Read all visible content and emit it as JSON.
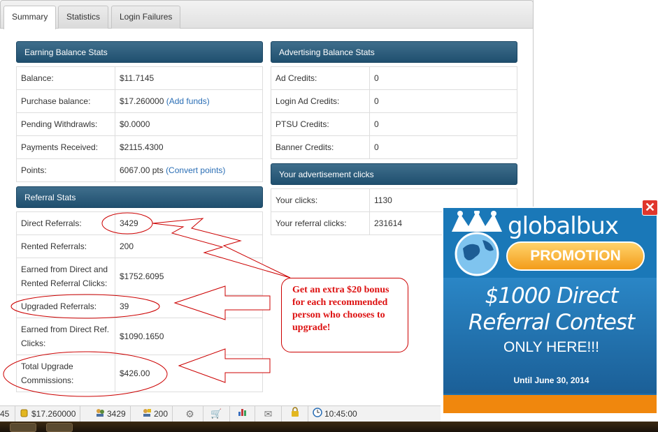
{
  "tabs": [
    {
      "label": "Summary",
      "active": true
    },
    {
      "label": "Statistics",
      "active": false
    },
    {
      "label": "Login Failures",
      "active": false
    }
  ],
  "earning": {
    "title": "Earning Balance Stats",
    "rows": [
      {
        "label": "Balance:",
        "value": "$11.7145"
      },
      {
        "label": "Purchase balance:",
        "value": "$17.260000",
        "link": "(Add funds)"
      },
      {
        "label": "Pending Withdrawls:",
        "value": "$0.0000"
      },
      {
        "label": "Payments Received:",
        "value": "$2115.4300"
      },
      {
        "label": "Points:",
        "value": "6067.00 pts",
        "link": "(Convert points)"
      }
    ]
  },
  "referral": {
    "title": "Referral Stats",
    "rows": [
      {
        "label": "Direct Referrals:",
        "value": "3429"
      },
      {
        "label": "Rented Referrals:",
        "value": "200"
      },
      {
        "label": "Earned from Direct and Rented Referral Clicks:",
        "value": "$1752.6095"
      },
      {
        "label": "Upgraded Referrals:",
        "value": "39"
      },
      {
        "label": "Earned from Direct Ref. Clicks:",
        "value": "$1090.1650"
      },
      {
        "label": "Total Upgrade Commissions:",
        "value": "$426.00"
      }
    ]
  },
  "advertising": {
    "title": "Advertising Balance Stats",
    "rows": [
      {
        "label": "Ad Credits:",
        "value": "0"
      },
      {
        "label": "Login Ad Credits:",
        "value": "0"
      },
      {
        "label": "PTSU Credits:",
        "value": "0"
      },
      {
        "label": "Banner Credits:",
        "value": "0"
      }
    ]
  },
  "clicks": {
    "title": "Your advertisement clicks",
    "rows": [
      {
        "label": "Your clicks:",
        "value": "1130"
      },
      {
        "label": "Your referral clicks:",
        "value": "231614"
      }
    ]
  },
  "annotation": {
    "text": "Get an extra $20 bonus for each recommended person who chooses to upgrade!",
    "color": "#cc0000"
  },
  "ad": {
    "logo": "globalbux",
    "promo": "PROMOTION",
    "line1": "$1000 Direct",
    "line2": "Referral Contest",
    "only": "ONLY HERE!!!",
    "until": "Until June 30, 2014",
    "close": "✕"
  },
  "statusbar": {
    "partial": "45",
    "balance": "$17.260000",
    "direct": "3429",
    "rented": "200",
    "time": "10:45:00"
  },
  "colors": {
    "header": "#1f4f6f",
    "link": "#2a6eb5",
    "ad_blue": "#1d6fae",
    "ad_orange": "#f0870d"
  }
}
